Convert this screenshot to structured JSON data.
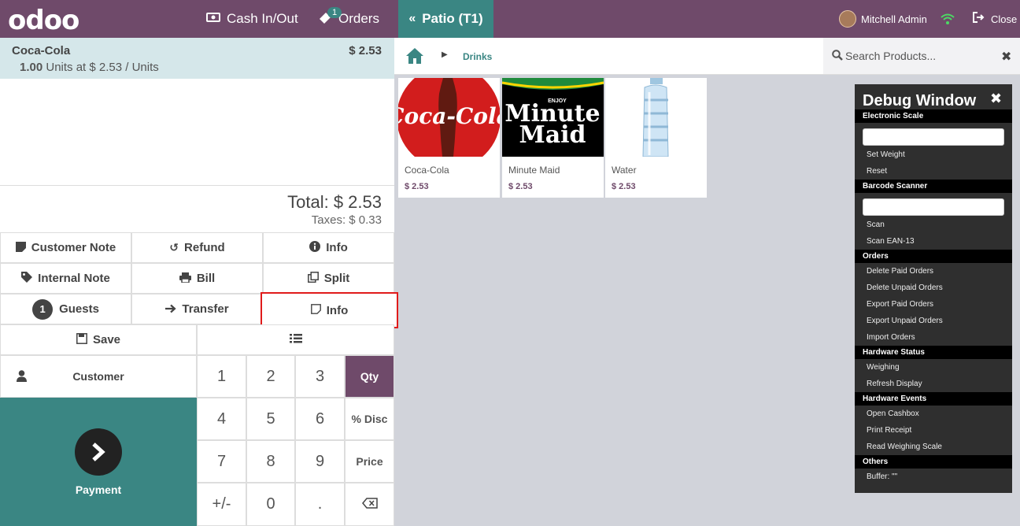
{
  "header": {
    "logo": "odoo",
    "cash_label": "Cash In/Out",
    "orders_label": "Orders",
    "orders_badge": "1",
    "active_tab": "Patio (T1)",
    "user_name": "Mitchell Admin",
    "close_label": "Close"
  },
  "order": {
    "line_name": "Coca-Cola",
    "line_price": "$ 2.53",
    "line_qty": "1.00",
    "line_detail": "Units at $ 2.53 / Units",
    "total": "Total: $ 2.53",
    "taxes": "Taxes: $ 0.33"
  },
  "controls": {
    "customer_note": "Customer Note",
    "refund": "Refund",
    "info": "Info",
    "internal_note": "Internal Note",
    "bill": "Bill",
    "split": "Split",
    "guests_count": "1",
    "guests": "Guests",
    "transfer": "Transfer",
    "info2": "Info",
    "save": "Save"
  },
  "numpad": {
    "customer": "Customer",
    "payment": "Payment",
    "keys": [
      "1",
      "2",
      "3",
      "4",
      "5",
      "6",
      "7",
      "8",
      "9",
      "+/-",
      "0",
      "."
    ],
    "modes": [
      "Qty",
      "% Disc",
      "Price"
    ],
    "active_mode": "Qty"
  },
  "breadcrumb": {
    "category": "Drinks"
  },
  "search": {
    "placeholder": "Search Products..."
  },
  "products": [
    {
      "name": "Coca-Cola",
      "price": "$ 2.53",
      "logo_text": "Coca-Cola"
    },
    {
      "name": "Minute Maid",
      "price": "$ 2.53",
      "logo_top": "ENJOY",
      "logo_line1": "Minute",
      "logo_line2": "Maid"
    },
    {
      "name": "Water",
      "price": "$ 2.53"
    }
  ],
  "debug": {
    "title": "Debug Window",
    "sections": {
      "scale": "Electronic Scale",
      "barcode": "Barcode Scanner",
      "orders": "Orders",
      "hardware_status": "Hardware Status",
      "hardware_events": "Hardware Events",
      "others": "Others"
    },
    "items": {
      "set_weight": "Set Weight",
      "reset": "Reset",
      "scan": "Scan",
      "scan_ean": "Scan EAN-13",
      "delete_paid": "Delete Paid Orders",
      "delete_unpaid": "Delete Unpaid Orders",
      "export_paid": "Export Paid Orders",
      "export_unpaid": "Export Unpaid Orders",
      "import_orders": "Import Orders",
      "weighing": "Weighing",
      "refresh_display": "Refresh Display",
      "open_cashbox": "Open Cashbox",
      "print_receipt": "Print Receipt",
      "read_scale": "Read Weighing Scale",
      "buffer": "Buffer: \"\""
    }
  }
}
